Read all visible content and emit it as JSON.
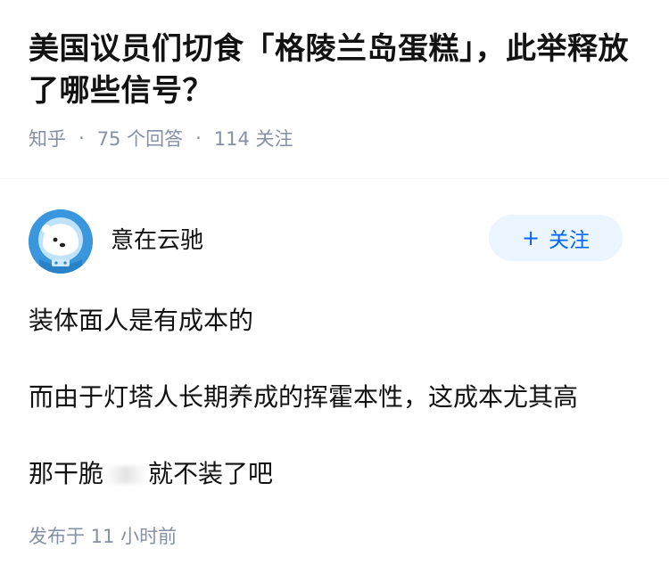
{
  "question": {
    "title": "美国议员们切食「格陵兰岛蛋糕」，此举释放了哪些信号？",
    "source": "知乎",
    "separator": "·",
    "answers_count": "75 个回答",
    "followers_count": "114 关注"
  },
  "answer": {
    "author": {
      "name": "意在云驰",
      "avatar_icon": "astronaut-bear-avatar"
    },
    "follow_button": {
      "plus": "+",
      "label": "关注"
    },
    "paragraphs": [
      "装体面人是有成本的",
      "而由于灯塔人长期养成的挥霍本性，这成本尤其高"
    ],
    "line3_before": "那干脆",
    "line3_after": "就不装了吧",
    "timestamp": "发布于 11 小时前"
  },
  "colors": {
    "accent": "#0066ff",
    "button_bg": "#ebf5ff",
    "meta": "#8590a6"
  }
}
